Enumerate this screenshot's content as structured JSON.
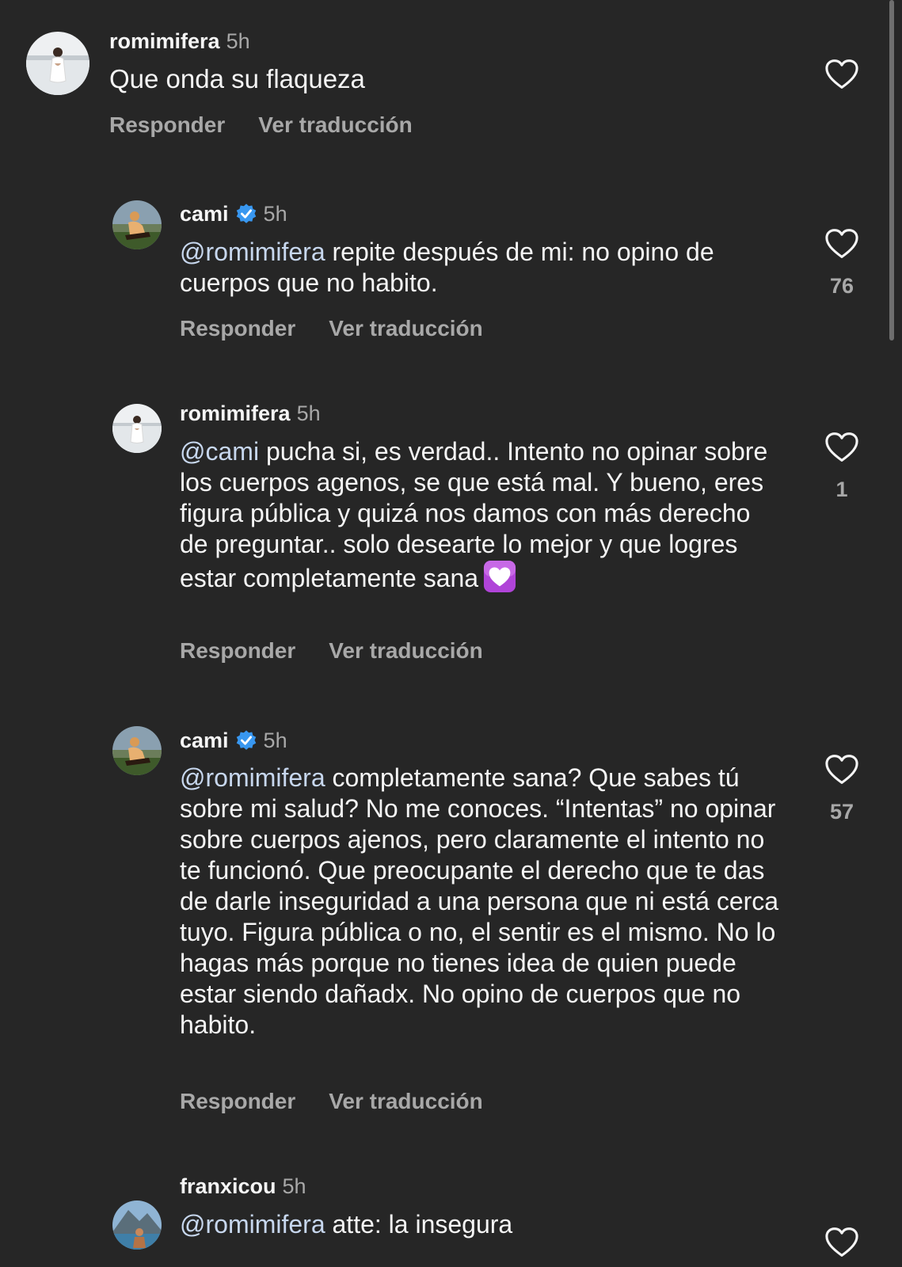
{
  "comments": [
    {
      "username": "romimifera",
      "time": "5h",
      "verified": false,
      "mention": "",
      "text": "Que onda su flaqueza",
      "reply_label": "Responder",
      "translate_label": "Ver traducción",
      "likes": "",
      "avatar_icon": "avatar-woman-white-dress-icon"
    },
    {
      "username": "cami",
      "time": "5h",
      "verified": true,
      "mention": "@romimifera",
      "text": " repite después de mi: no opino de cuerpos que no habito.",
      "reply_label": "Responder",
      "translate_label": "Ver traducción",
      "likes": "76",
      "avatar_icon": "avatar-woman-outdoors-icon"
    },
    {
      "username": "romimifera",
      "time": "5h",
      "verified": false,
      "mention": "@cami",
      "text": " pucha si, es verdad.. Intento no opinar sobre los cuerpos agenos, se que está mal. Y bueno, eres figura pública y quizá nos damos con más derecho de preguntar.. solo desearte lo mejor y que logres estar completamente sana",
      "emoji": "heart-with-ribbon-emoji",
      "reply_label": "Responder",
      "translate_label": "Ver traducción",
      "likes": "1",
      "avatar_icon": "avatar-woman-white-dress-icon"
    },
    {
      "username": "cami",
      "time": "5h",
      "verified": true,
      "mention": "@romimifera",
      "text": " completamente sana? Que sabes tú sobre mi salud? No me conoces. “Intentas” no opinar sobre cuerpos ajenos, pero claramente el intento no te funcionó. Que preocupante el derecho que te das de darle inseguridad a una persona que ni está cerca tuyo. Figura pública o no, el sentir es el mismo. No lo hagas más porque no tienes idea de quien puede estar siendo dañadx. No opino de cuerpos que no habito.",
      "reply_label": "Responder",
      "translate_label": "Ver traducción",
      "likes": "57",
      "avatar_icon": "avatar-woman-outdoors-icon"
    },
    {
      "username": "franxicou",
      "time": "5h",
      "verified": false,
      "mention": "@romimifera",
      "text": " atte: la insegura",
      "reply_label": "",
      "translate_label": "",
      "likes": "",
      "avatar_icon": "avatar-mountain-sea-icon"
    }
  ],
  "colors": {
    "background": "#262626",
    "text": "#f5f5f5",
    "secondary": "#a8a8a8",
    "mention": "#c7d7ee",
    "verified": "#3897f0"
  }
}
